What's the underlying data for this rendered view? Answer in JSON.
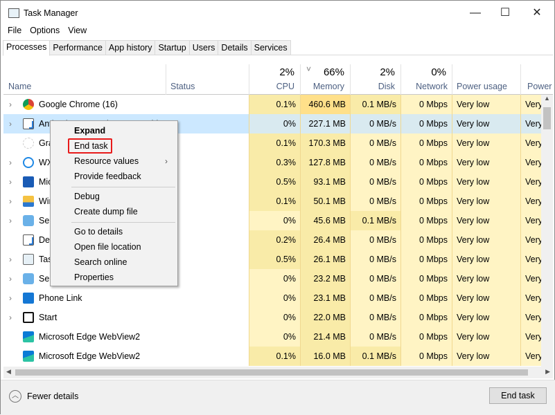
{
  "window": {
    "title": "Task Manager",
    "minimize": "—",
    "maximize": "☐",
    "close": "✕"
  },
  "menu": [
    "File",
    "Options",
    "View"
  ],
  "tabs": [
    "Processes",
    "Performance",
    "App history",
    "Startup",
    "Users",
    "Details",
    "Services"
  ],
  "columns": {
    "name": "Name",
    "status": "Status",
    "cpu": {
      "pct": "2%",
      "label": "CPU"
    },
    "memory": {
      "pct": "66%",
      "label": "Memory",
      "sort": "˅"
    },
    "disk": {
      "pct": "2%",
      "label": "Disk"
    },
    "network": {
      "pct": "0%",
      "label": "Network"
    },
    "power": "Power usage",
    "power_trend": "Power"
  },
  "processes": [
    {
      "name": "Google Chrome (16)",
      "icon": "chrome-icon",
      "expand": true,
      "cpu": "0.1%",
      "mem": "460.6 MB",
      "disk": "0.1 MB/s",
      "net": "0 Mbps",
      "power": "Very low",
      "trend": "Very"
    },
    {
      "name": "Antimalware Service Executable",
      "icon": "window-icon",
      "expand": true,
      "selected": true,
      "cpu": "0%",
      "mem": "227.1 MB",
      "disk": "0 MB/s",
      "net": "0 Mbps",
      "power": "Very low",
      "trend": "Very"
    },
    {
      "name": "Gra",
      "icon": "app-icon",
      "expand": false,
      "cpu": "0.1%",
      "mem": "170.3 MB",
      "disk": "0 MB/s",
      "net": "0 Mbps",
      "power": "Very low",
      "trend": "Very"
    },
    {
      "name": "WX",
      "icon": "wx-icon",
      "expand": true,
      "cpu": "0.3%",
      "mem": "127.8 MB",
      "disk": "0 MB/s",
      "net": "0 Mbps",
      "power": "Very low",
      "trend": "Very"
    },
    {
      "name": "Mic",
      "icon": "word-icon",
      "expand": true,
      "cpu": "0.5%",
      "mem": "93.1 MB",
      "disk": "0 MB/s",
      "net": "0 Mbps",
      "power": "Very low",
      "trend": "Very"
    },
    {
      "name": "Win",
      "icon": "folder-icon",
      "expand": true,
      "cpu": "0.1%",
      "mem": "50.1 MB",
      "disk": "0 MB/s",
      "net": "0 Mbps",
      "power": "Very low",
      "trend": "Very"
    },
    {
      "name": "Ser",
      "icon": "gear-icon",
      "expand": true,
      "cpu": "0%",
      "mem": "45.6 MB",
      "disk": "0.1 MB/s",
      "net": "0 Mbps",
      "power": "Very low",
      "trend": "Very"
    },
    {
      "name": "Des",
      "icon": "window-icon",
      "expand": false,
      "cpu": "0.2%",
      "mem": "26.4 MB",
      "disk": "0 MB/s",
      "net": "0 Mbps",
      "power": "Very low",
      "trend": "Very"
    },
    {
      "name": "Tas",
      "icon": "taskmanager-icon",
      "expand": true,
      "cpu": "0.5%",
      "mem": "26.1 MB",
      "disk": "0 MB/s",
      "net": "0 Mbps",
      "power": "Very low",
      "trend": "Very"
    },
    {
      "name": "Ser",
      "icon": "gear-icon",
      "expand": true,
      "cpu": "0%",
      "mem": "23.2 MB",
      "disk": "0 MB/s",
      "net": "0 Mbps",
      "power": "Very low",
      "trend": "Very"
    },
    {
      "name": "Phone Link",
      "icon": "phone-icon",
      "expand": true,
      "cpu": "0%",
      "mem": "23.1 MB",
      "disk": "0 MB/s",
      "net": "0 Mbps",
      "power": "Very low",
      "trend": "Very"
    },
    {
      "name": "Start",
      "icon": "start-icon",
      "expand": true,
      "cpu": "0%",
      "mem": "22.0 MB",
      "disk": "0 MB/s",
      "net": "0 Mbps",
      "power": "Very low",
      "trend": "Very"
    },
    {
      "name": "Microsoft Edge WebView2",
      "icon": "edge-webview-icon",
      "expand": false,
      "cpu": "0%",
      "mem": "21.4 MB",
      "disk": "0 MB/s",
      "net": "0 Mbps",
      "power": "Very low",
      "trend": "Very"
    },
    {
      "name": "Microsoft Edge WebView2",
      "icon": "edge-webview-icon",
      "expand": false,
      "cpu": "0.1%",
      "mem": "16.0 MB",
      "disk": "0.1 MB/s",
      "net": "0 Mbps",
      "power": "Very low",
      "trend": "Very"
    }
  ],
  "context_menu": {
    "items": [
      "Expand",
      "End task",
      "Resource values",
      "Provide feedback",
      "Debug",
      "Create dump file",
      "Go to details",
      "Open file location",
      "Search online",
      "Properties"
    ],
    "highlighted": "End task",
    "highlight_color": "#e81a1a"
  },
  "footer": {
    "fewer_details": "Fewer details",
    "end_task": "End task"
  }
}
